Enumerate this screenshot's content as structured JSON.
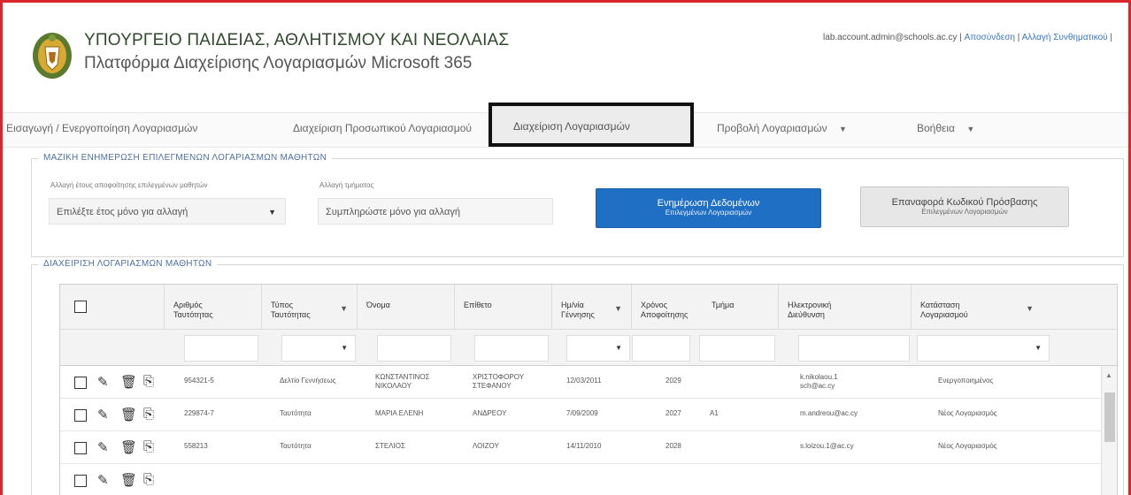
{
  "header": {
    "title1": "ΥΠΟΥΡΓΕΙΟ ΠΑΙΔΕΙΑΣ, ΑΘΛΗΤΙΣΜΟΥ ΚΑΙ ΝΕΟΛΑΙΑΣ",
    "title2": "Πλατφόρμα Διαχείρισης Λογαριασμών Microsoft 365",
    "user_email": "lab.account.admin@schools.ac.cy",
    "logout_label": "Αποσύνδεση",
    "change_password_label": "Αλλαγή Συνθηματικού"
  },
  "nav": {
    "items": [
      {
        "label": "Εισαγωγή / Ενεργοποίηση Λογαριασμών"
      },
      {
        "label": "Διαχείριση Προσωπικού Λογαριασμού"
      },
      {
        "label": "Διαχείριση Λογαριασμών"
      },
      {
        "label": "Προβολή Λογαριασμών"
      },
      {
        "label": "Βοήθεια"
      }
    ],
    "active_index": 2
  },
  "bulk": {
    "legend": "ΜΑΖΙΚΗ ΕΝΗΜΕΡΩΣΗ ΕΠΙΛΕΓΜΕΝΩΝ ΛΟΓΑΡΙΑΣΜΩΝ ΜΑΘΗΤΩΝ",
    "field1_label": "Αλλαγή έτους αποφοίτησης επιλεγμένων μαθητών",
    "field1_value": "Επιλέξτε έτος μόνο για αλλαγή",
    "field2_label": "Αλλαγή τμήματος",
    "field2_value": "Συμπληρώστε μόνο για αλλαγή",
    "primary_btn_line1": "Ενημέρωση Δεδομένων",
    "primary_btn_line2": "Επιλεγμένων Λογαριασμών",
    "secondary_btn_line1": "Επαναφορά Κωδικού Πρόσβασης",
    "secondary_btn_line2": "Επιλεγμένων Λογαριασμών"
  },
  "table": {
    "legend": "ΔΙΑΧΕΙΡΙΣΗ ΛΟΓΑΡΙΑΣΜΩΝ ΜΑΘΗΤΩΝ",
    "columns": [
      {
        "line1": "Αριθμός",
        "line2": "Ταυτότητας"
      },
      {
        "line1": "Τύπος",
        "line2": "Ταυτότητας"
      },
      {
        "line1": "Όνομα",
        "line2": ""
      },
      {
        "line1": "Επίθετο",
        "line2": ""
      },
      {
        "line1": "Ημ/νία",
        "line2": "Γέννησης"
      },
      {
        "line1": "Χρόνος",
        "line2": "Αποφοίτησης"
      },
      {
        "line1": "Τμήμα",
        "line2": ""
      },
      {
        "line1": "Ηλεκτρονική",
        "line2": "Διεύθυνση"
      },
      {
        "line1": "Κατάσταση",
        "line2": "Λογαριασμού"
      }
    ],
    "rows": [
      {
        "id": "954321-5",
        "type": "Δελτίο Γεννήσεως",
        "first": "ΚΩΝΣΤΑΝΤΙΝΟΣ",
        "first2": "ΝΙΚΟΛΑΟΥ",
        "last": "ΧΡΙΣΤΟΦΟΡΟΥ",
        "last2": "ΣΤΕΦΑΝΟΥ",
        "dob": "12/03/2011",
        "grad": "2029",
        "class": "",
        "email1": "k.nikolaou.1",
        "email2": "sch@ac.cy",
        "status": "Ενεργοποιημένος"
      },
      {
        "id": "229874-7",
        "type": "Ταυτότητα",
        "first": "ΜΑΡΙΑ ΕΛΕΝΗ",
        "first2": "",
        "last": "ΑΝΔΡΕΟΥ",
        "last2": "",
        "dob": "7/09/2009",
        "grad": "2027",
        "class": "Α1",
        "email1": "m.andreou@ac.cy",
        "email2": "",
        "status": "Νέος Λογαριασμός"
      },
      {
        "id": "558213",
        "type": "Ταυτότητα",
        "first": "ΣΤΕΛΙΟΣ",
        "first2": "",
        "last": "ΛΟΙΖΟΥ",
        "last2": "",
        "dob": "14/11/2010",
        "grad": "2028",
        "class": "",
        "email1": "s.loizou.1@ac.cy",
        "email2": "",
        "status": "Νέος Λογαριασμός"
      }
    ]
  }
}
